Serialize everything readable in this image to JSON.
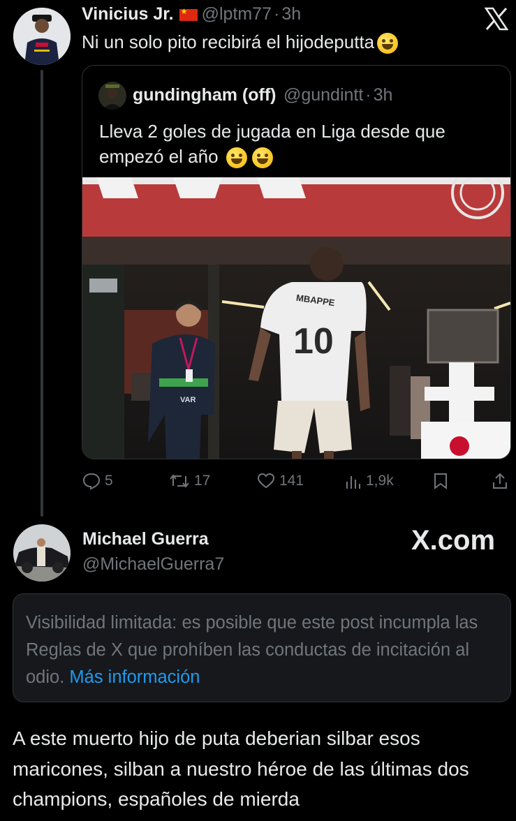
{
  "main_tweet": {
    "author_name": "Vinicius Jr.",
    "flag": "china-flag",
    "handle": "@lptm77",
    "separator": "·",
    "time": "3h",
    "text": "Ni un solo pito recibirá el hijodeputta",
    "text_emoji": "grinning-emoji"
  },
  "quoted_tweet": {
    "author_name": "gundingham (off)",
    "handle": "@gundintt",
    "separator": "·",
    "time": "3h",
    "text_line1": "Lleva 2 goles de jugada en Liga desde que",
    "text_line2": "empezó el año",
    "shirt_name": "MBAPPE",
    "shirt_number": "10",
    "vest_label": "VAR"
  },
  "actions": {
    "replies": "5",
    "reposts": "17",
    "likes": "141",
    "views": "1,9k"
  },
  "reply": {
    "author_name": "Michael Guerra",
    "handle": "@MichaelGuerra7",
    "watermark": "X.com",
    "notice_text": "Visibilidad limitada: es posible que este post incumpla las Reglas de X que prohíben las conductas de incitación al odio.",
    "notice_link": "Más información",
    "body": "A este muerto hijo de puta deberian silbar esos maricones, silban a nuestro héroe de las últimas dos champions, españoles de mierda"
  },
  "colors": {
    "background": "#000000",
    "text": "#e7e9ea",
    "muted": "#71767b",
    "link": "#1d9bf0",
    "border": "#2f3336"
  }
}
